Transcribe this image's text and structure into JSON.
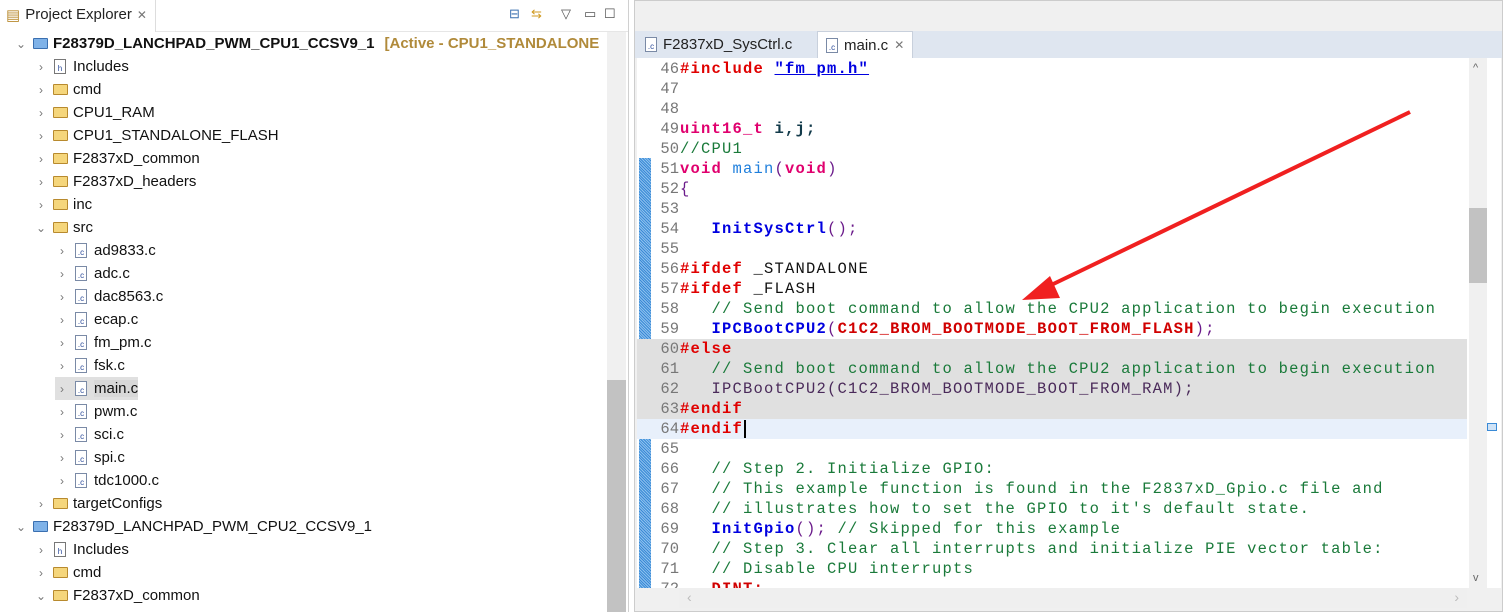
{
  "explorer": {
    "title": "Project Explorer",
    "rows": [
      {
        "level": 0,
        "chev": "v",
        "icon": "project",
        "label": "F28379D_LANCHPAD_PWM_CPU1_CCSV9_1",
        "suffix": "[Active - CPU1_STANDALONE",
        "bold": true
      },
      {
        "level": 1,
        "chev": ">",
        "icon": "includes",
        "label": "Includes"
      },
      {
        "level": 1,
        "chev": ">",
        "icon": "folder",
        "label": "cmd"
      },
      {
        "level": 1,
        "chev": ">",
        "icon": "folder",
        "label": "CPU1_RAM"
      },
      {
        "level": 1,
        "chev": ">",
        "icon": "folder",
        "label": "CPU1_STANDALONE_FLASH"
      },
      {
        "level": 1,
        "chev": ">",
        "icon": "folder",
        "label": "F2837xD_common"
      },
      {
        "level": 1,
        "chev": ">",
        "icon": "folder",
        "label": "F2837xD_headers"
      },
      {
        "level": 1,
        "chev": ">",
        "icon": "folder",
        "label": "inc"
      },
      {
        "level": 1,
        "chev": "v",
        "icon": "folder",
        "label": "src"
      },
      {
        "level": 2,
        "chev": ">",
        "icon": "cfile",
        "label": "ad9833.c"
      },
      {
        "level": 2,
        "chev": ">",
        "icon": "cfile",
        "label": "adc.c"
      },
      {
        "level": 2,
        "chev": ">",
        "icon": "cfile",
        "label": "dac8563.c"
      },
      {
        "level": 2,
        "chev": ">",
        "icon": "cfile",
        "label": "ecap.c"
      },
      {
        "level": 2,
        "chev": ">",
        "icon": "cfile",
        "label": "fm_pm.c"
      },
      {
        "level": 2,
        "chev": ">",
        "icon": "cfile",
        "label": "fsk.c"
      },
      {
        "level": 2,
        "chev": ">",
        "icon": "cfile",
        "label": "main.c",
        "selected": true
      },
      {
        "level": 2,
        "chev": ">",
        "icon": "cfile",
        "label": "pwm.c"
      },
      {
        "level": 2,
        "chev": ">",
        "icon": "cfile",
        "label": "sci.c"
      },
      {
        "level": 2,
        "chev": ">",
        "icon": "cfile",
        "label": "spi.c"
      },
      {
        "level": 2,
        "chev": ">",
        "icon": "cfile",
        "label": "tdc1000.c"
      },
      {
        "level": 1,
        "chev": ">",
        "icon": "folder",
        "label": "targetConfigs"
      },
      {
        "level": 0,
        "chev": "v",
        "icon": "project",
        "label": "F28379D_LANCHPAD_PWM_CPU2_CCSV9_1"
      },
      {
        "level": 1,
        "chev": ">",
        "icon": "includes",
        "label": "Includes"
      },
      {
        "level": 1,
        "chev": ">",
        "icon": "folder",
        "label": "cmd"
      },
      {
        "level": 1,
        "chev": "v",
        "icon": "folder",
        "label": "F2837xD_common"
      }
    ]
  },
  "editor": {
    "tabs": [
      {
        "label": "F2837xD_SysCtrl.c",
        "active": false
      },
      {
        "label": "main.c",
        "active": true
      }
    ],
    "lines": [
      {
        "n": "46",
        "t": [
          [
            "#include ",
            "kw-pp"
          ],
          [
            "\"fm_pm.h\"",
            "str"
          ]
        ]
      },
      {
        "n": "47",
        "t": []
      },
      {
        "n": "48",
        "t": []
      },
      {
        "n": "49",
        "t": [
          [
            "uint16_t ",
            "kw-t"
          ],
          [
            "i,j;",
            "var"
          ]
        ]
      },
      {
        "n": "50",
        "t": [
          [
            "//CPU1",
            "cm"
          ]
        ]
      },
      {
        "n": "51",
        "t": [
          [
            "void ",
            "kw-t"
          ],
          [
            "main",
            "fnd"
          ],
          [
            "(",
            "pu"
          ],
          [
            "void",
            "kw-t"
          ],
          [
            ")",
            "pu"
          ]
        ]
      },
      {
        "n": "52",
        "t": [
          [
            "{",
            "pu"
          ]
        ]
      },
      {
        "n": "53",
        "t": []
      },
      {
        "n": "54",
        "t": [
          [
            "   ",
            "pl"
          ],
          [
            "InitSysCtrl",
            "fn"
          ],
          [
            "();",
            "pu"
          ]
        ]
      },
      {
        "n": "55",
        "t": []
      },
      {
        "n": "56",
        "t": [
          [
            "#ifdef ",
            "kw-pp"
          ],
          [
            "_STANDALONE",
            "pl"
          ]
        ]
      },
      {
        "n": "57",
        "t": [
          [
            "#ifdef ",
            "kw-pp"
          ],
          [
            "_FLASH",
            "pl"
          ]
        ]
      },
      {
        "n": "58",
        "t": [
          [
            "   ",
            "pl"
          ],
          [
            "// Send boot command to allow the CPU2 application to begin execution",
            "cm"
          ]
        ]
      },
      {
        "n": "59",
        "t": [
          [
            "   ",
            "pl"
          ],
          [
            "IPCBootCPU2",
            "fn"
          ],
          [
            "(",
            "pu"
          ],
          [
            "C1C2_BROM_BOOTMODE_BOOT_FROM_FLASH",
            "mac"
          ],
          [
            ");",
            "pu"
          ]
        ]
      },
      {
        "n": "60",
        "t": [
          [
            "#else",
            "kw-pp"
          ]
        ],
        "bg": "grey"
      },
      {
        "n": "61",
        "t": [
          [
            "   ",
            "pl"
          ],
          [
            "// Send boot command to allow the CPU2 application to begin execution",
            "cm"
          ]
        ],
        "bg": "grey"
      },
      {
        "n": "62",
        "t": [
          [
            "   ",
            "pl"
          ],
          [
            "IPCBootCPU2(C1C2_BROM_BOOTMODE_BOOT_FROM_RAM);",
            "dim"
          ]
        ],
        "bg": "grey"
      },
      {
        "n": "63",
        "t": [
          [
            "#endif",
            "kw-pp"
          ]
        ],
        "bg": "grey"
      },
      {
        "n": "64",
        "t": [
          [
            "#endif",
            "kw-pp"
          ]
        ],
        "bg": "cur"
      },
      {
        "n": "65",
        "t": []
      },
      {
        "n": "66",
        "t": [
          [
            "   ",
            "pl"
          ],
          [
            "// Step 2. Initialize GPIO:",
            "cm"
          ]
        ]
      },
      {
        "n": "67",
        "t": [
          [
            "   ",
            "pl"
          ],
          [
            "// This example function is found in the F2837xD_Gpio.c file and",
            "cm"
          ]
        ]
      },
      {
        "n": "68",
        "t": [
          [
            "   ",
            "pl"
          ],
          [
            "// illustrates how to set the GPIO to it's default state.",
            "cm"
          ]
        ]
      },
      {
        "n": "69",
        "t": [
          [
            "   ",
            "pl"
          ],
          [
            "InitGpio",
            "fn"
          ],
          [
            "();",
            "pu"
          ],
          [
            " // Skipped for this example",
            "cm"
          ]
        ]
      },
      {
        "n": "70",
        "t": [
          [
            "   ",
            "pl"
          ],
          [
            "// Step 3. Clear all interrupts and initialize PIE vector table:",
            "cm"
          ]
        ]
      },
      {
        "n": "71",
        "t": [
          [
            "   ",
            "pl"
          ],
          [
            "// Disable CPU interrupts",
            "cm"
          ]
        ]
      },
      {
        "n": "72",
        "t": [
          [
            "   ",
            "pl"
          ],
          [
            "DINT;",
            "mac"
          ]
        ]
      }
    ]
  },
  "colors": {
    "arrow": "#f02020",
    "accent": "#3a8ad6"
  }
}
